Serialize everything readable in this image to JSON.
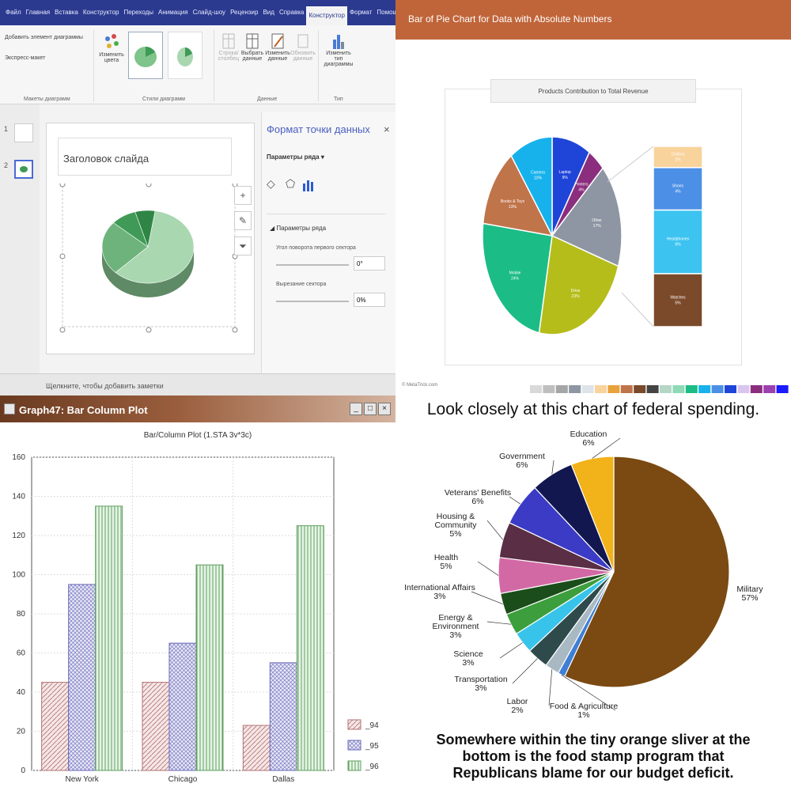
{
  "panel_top_left": {
    "ribbon_tabs": [
      "Файл",
      "Главная",
      "Вставка",
      "Конструктор",
      "Переходы",
      "Анимация",
      "Слайд-шоу",
      "Рецензир",
      "Вид",
      "Справка",
      "Конструктор",
      "Формат",
      "Помощник",
      "Поделиться"
    ],
    "ribbon": {
      "add_element": "Добавить элемент диаграммы",
      "express_layout": "Экспресс-макет",
      "change_colors": "Изменить цвета",
      "switch_rows": "Строка/столбец",
      "select_data": "Выбрать данные",
      "edit_data": "Изменить данные",
      "refresh_data": "Обновить данные",
      "change_type": "Изменить тип диаграммы",
      "group_layouts": "Макеты диаграмм",
      "group_styles": "Стили диаграмм",
      "group_data": "Данные",
      "group_type": "Тип"
    },
    "slides": [
      "1",
      "2"
    ],
    "slide_title_placeholder": "Заголовок слайда",
    "format_pane": {
      "title": "Формат точки данных",
      "series_options": "Параметры ряда",
      "series_section": "Параметры ряда",
      "first_angle_label": "Угол поворота первого сектора",
      "first_angle_value": "0°",
      "explosion_label": "Вырезание сектора",
      "explosion_value": "0%"
    },
    "notes_placeholder": "Щелкните, чтобы добавить заметки",
    "chart_data": {
      "type": "pie",
      "title": "",
      "values": [
        60,
        24,
        9,
        7
      ],
      "colors": [
        "#a9d7b0",
        "#6fb37c",
        "#3f9a57",
        "#2f8545"
      ]
    }
  },
  "panel_top_right": {
    "header_title": "Bar of Pie Chart for Data with Absolute Numbers",
    "footer_source": "© MetaTrick.com",
    "chart_data": {
      "type": "pie",
      "title": "Products Contribution to Total Revenue",
      "pie_slices": [
        {
          "label": "Laptop",
          "pct": "9%",
          "value": 9,
          "color": "#1f45d8"
        },
        {
          "label": "Printers",
          "pct": "4%",
          "value": 4,
          "color": "#8b2e7e"
        },
        {
          "label": "Other",
          "pct": "17%",
          "value": 17,
          "color": "#8e96a3"
        },
        {
          "label": "Drive",
          "pct": "23%",
          "value": 23,
          "color": "#b5bd1b"
        },
        {
          "label": "Mobile",
          "pct": "24%",
          "value": 24,
          "color": "#1cbc86"
        },
        {
          "label": "Books & Toys",
          "pct": "13%",
          "value": 13,
          "color": "#c0744a"
        },
        {
          "label": "Camera",
          "pct": "10%",
          "value": 10,
          "color": "#17b2ec"
        }
      ],
      "bar_segments": [
        {
          "label": "Watches",
          "pct": "5%",
          "value": 5,
          "color": "#7a4a2a"
        },
        {
          "label": "Headphones",
          "pct": "6%",
          "value": 6,
          "color": "#3cc3f0"
        },
        {
          "label": "Shoes",
          "pct": "4%",
          "value": 4,
          "color": "#4c8fe6"
        },
        {
          "label": "Clothes",
          "pct": "2%",
          "value": 2,
          "color": "#f8d39c"
        }
      ],
      "palette": [
        "#d9d9d9",
        "#bfbfbf",
        "#a6a6a6",
        "#8e96a3",
        "#dfe3ea",
        "#f8d39c",
        "#e8a33c",
        "#c0744a",
        "#7a4a2a",
        "#444444",
        "#b5d7c6",
        "#8fd9b6",
        "#1cbc86",
        "#17b2ec",
        "#4c8fe6",
        "#1f45d8",
        "#d8c6ef",
        "#8b2e7e",
        "#9c3fb0",
        "#1a1aff"
      ]
    }
  },
  "panel_bottom_left": {
    "window_title": "Graph47: Bar Column Plot",
    "window_buttons": [
      "_",
      "□",
      "×"
    ],
    "chart_data": {
      "type": "bar",
      "title": "Bar/Column Plot (1.STA 3v*3c)",
      "categories": [
        "New York",
        "Chicago",
        "Dallas"
      ],
      "series": [
        {
          "name": "_94",
          "values": [
            45,
            45,
            23
          ],
          "color": "#b07070",
          "fill": "#f6e6e6"
        },
        {
          "name": "_95",
          "values": [
            95,
            65,
            55
          ],
          "color": "#6868b8",
          "fill": "#e6e6f6"
        },
        {
          "name": "_96",
          "values": [
            135,
            105,
            125
          ],
          "color": "#5f9f5f",
          "fill": "#e6f4e6"
        }
      ],
      "ylim": [
        0,
        160
      ],
      "yticks": [
        0,
        20,
        40,
        60,
        80,
        100,
        120,
        140,
        160
      ],
      "grid": true,
      "legend": "bottom-right"
    }
  },
  "panel_bottom_right": {
    "headline": "Look closely at this chart of federal spending.",
    "caption_lines": [
      "Somewhere within the tiny orange sliver at the",
      "bottom is the food stamp program that",
      "Republicans blame for our budget deficit."
    ],
    "chart_data": {
      "type": "pie",
      "title": "",
      "slices": [
        {
          "label": "Military",
          "pct": "57%",
          "value": 57,
          "color": "#7a4a12"
        },
        {
          "label": "Food & Agriculture",
          "pct": "1%",
          "value": 1,
          "color": "#3f7fd6"
        },
        {
          "label": "Labor",
          "pct": "2%",
          "value": 2,
          "color": "#a9b9c3"
        },
        {
          "label": "Transportation",
          "pct": "3%",
          "value": 3,
          "color": "#2f4a4a"
        },
        {
          "label": "Science",
          "pct": "3%",
          "value": 3,
          "color": "#38c4ea"
        },
        {
          "label": "Energy & Environment",
          "pct": "3%",
          "value": 3,
          "color": "#3c9e3c"
        },
        {
          "label": "International Affairs",
          "pct": "3%",
          "value": 3,
          "color": "#1b4d1b"
        },
        {
          "label": "Health",
          "pct": "5%",
          "value": 5,
          "color": "#d269a4"
        },
        {
          "label": "Housing & Community",
          "pct": "5%",
          "value": 5,
          "color": "#5a2e44"
        },
        {
          "label": "Veterans' Benefits",
          "pct": "6%",
          "value": 6,
          "color": "#3b3bc6"
        },
        {
          "label": "Government",
          "pct": "6%",
          "value": 6,
          "color": "#12174f"
        },
        {
          "label": "Education",
          "pct": "6%",
          "value": 6,
          "color": "#f1b21a"
        }
      ]
    }
  }
}
